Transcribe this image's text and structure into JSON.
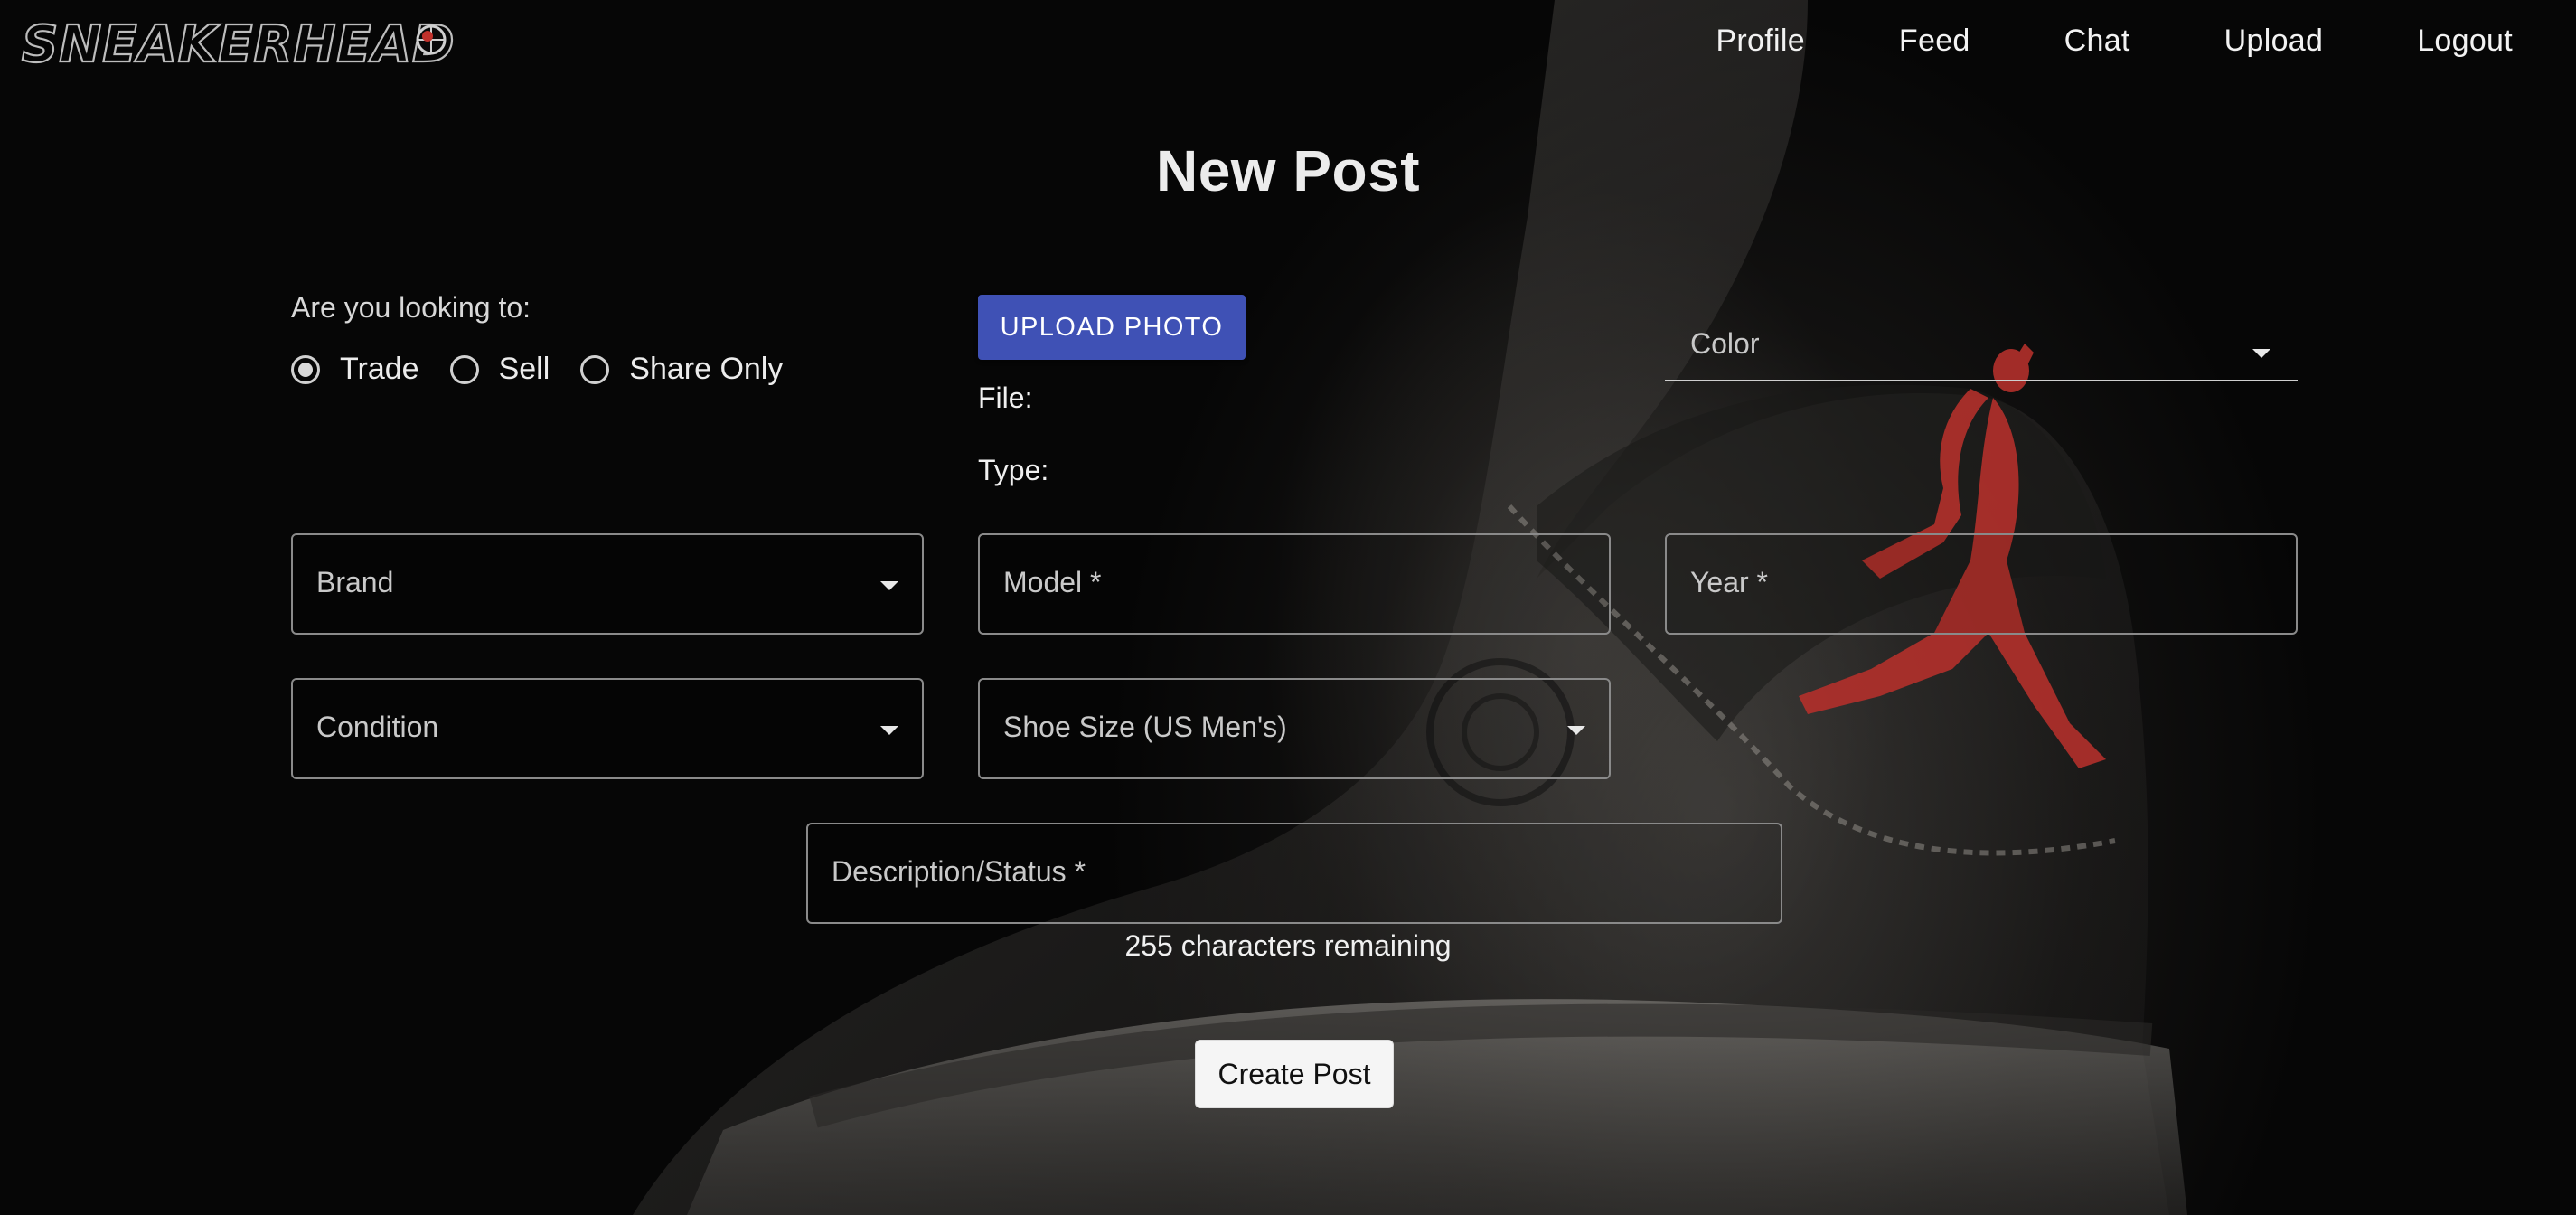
{
  "app": {
    "logo_text": "SNEAKERHEADS"
  },
  "nav": {
    "items": [
      {
        "label": "Profile"
      },
      {
        "label": "Feed"
      },
      {
        "label": "Chat"
      },
      {
        "label": "Upload"
      },
      {
        "label": "Logout"
      }
    ]
  },
  "page": {
    "title": "New Post"
  },
  "form": {
    "intent": {
      "label": "Are you looking to:",
      "selected": "Trade",
      "options": [
        {
          "label": "Trade",
          "checked": true
        },
        {
          "label": "Sell",
          "checked": false
        },
        {
          "label": "Share Only",
          "checked": false
        }
      ]
    },
    "upload": {
      "button_label": "UPLOAD PHOTO",
      "file_label": "File:",
      "type_label": "Type:"
    },
    "color": {
      "label": "Color"
    },
    "brand": {
      "label": "Brand"
    },
    "model": {
      "label": "Model *"
    },
    "year": {
      "label": "Year *"
    },
    "condition": {
      "label": "Condition"
    },
    "shoe_size": {
      "label": "Shoe Size (US Men's)"
    },
    "description": {
      "label": "Description/Status *"
    },
    "char_counter": "255 characters remaining",
    "submit_label": "Create Post"
  },
  "colors": {
    "primary_button": "#3f51b5",
    "background": "#060606",
    "logo_emblem_red": "#c0312b"
  },
  "icons": {
    "dropdown": "chevron-down-icon",
    "logo_emblem": "basketball-icon"
  }
}
